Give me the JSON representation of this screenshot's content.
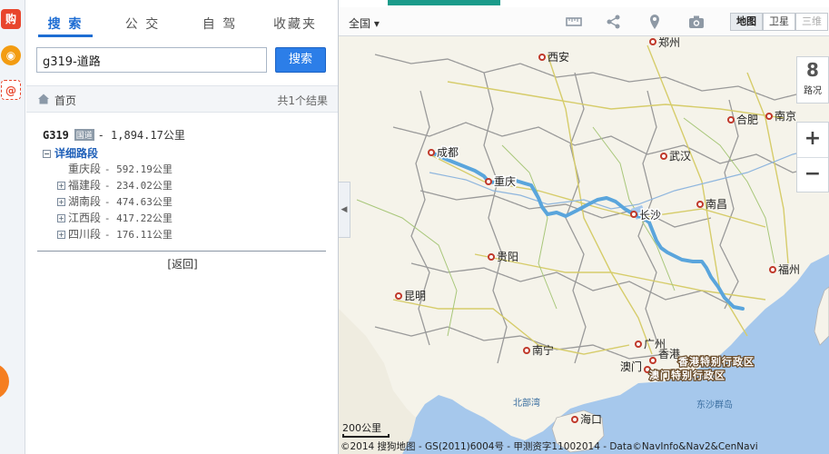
{
  "strip": {
    "shop_glyph": "购",
    "mail_glyph": "@"
  },
  "tabs": [
    {
      "label": "搜 索",
      "active": true
    },
    {
      "label": "公 交",
      "active": false
    },
    {
      "label": "自 驾",
      "active": false
    },
    {
      "label": "收藏夹",
      "active": false
    }
  ],
  "search": {
    "value": "g319-道路",
    "button_label": "搜索"
  },
  "crumb": {
    "home": "首页",
    "count": "共1个结果"
  },
  "result": {
    "title": "G319",
    "badge": "国道",
    "distance": "- 1,894.17公里",
    "detail_label": "详细路段",
    "segments": [
      {
        "name": "重庆段",
        "distance": "- 592.19公里",
        "expandable": false
      },
      {
        "name": "福建段",
        "distance": "- 234.02公里",
        "expandable": true
      },
      {
        "name": "湖南段",
        "distance": "- 474.63公里",
        "expandable": true
      },
      {
        "name": "江西段",
        "distance": "- 417.22公里",
        "expandable": true
      },
      {
        "name": "四川段",
        "distance": "- 176.11公里",
        "expandable": true
      }
    ],
    "back": "[返回]"
  },
  "toolbar": {
    "region": "全国 ▾",
    "icons": [
      "ruler-icon",
      "share-icon",
      "location-pin-icon",
      "camera-icon"
    ],
    "map_types": [
      {
        "label": "地图",
        "state": "active"
      },
      {
        "label": "卫星",
        "state": "normal"
      },
      {
        "label": "三维",
        "state": "disabled"
      }
    ]
  },
  "traffic": {
    "glyph": "8",
    "label": "路况"
  },
  "zoom": {
    "in": "+",
    "out": "−"
  },
  "map": {
    "route_color": "#5aa5dc",
    "cities": [
      {
        "name": "郑州"
      },
      {
        "name": "西安"
      },
      {
        "name": "合肥"
      },
      {
        "name": "南京"
      },
      {
        "name": "成都"
      },
      {
        "name": "武汉"
      },
      {
        "name": "重庆"
      },
      {
        "name": "长沙"
      },
      {
        "name": "南昌"
      },
      {
        "name": "贵阳"
      },
      {
        "name": "福州"
      },
      {
        "name": "昆明"
      },
      {
        "name": "南宁"
      },
      {
        "name": "广州"
      },
      {
        "name": "香港"
      },
      {
        "name": "澳门"
      },
      {
        "name": "海口"
      }
    ],
    "sar_labels": [
      "香港特别行政区",
      "澳门特别行政区"
    ],
    "sea_labels": [
      "北部湾",
      "东沙群岛"
    ],
    "scale": "200公里",
    "copyright": "©2014 搜狗地图 - GS(2011)6004号 - 甲测资字11002014 - Data©NavInfo&Nav2&CenNavi"
  }
}
